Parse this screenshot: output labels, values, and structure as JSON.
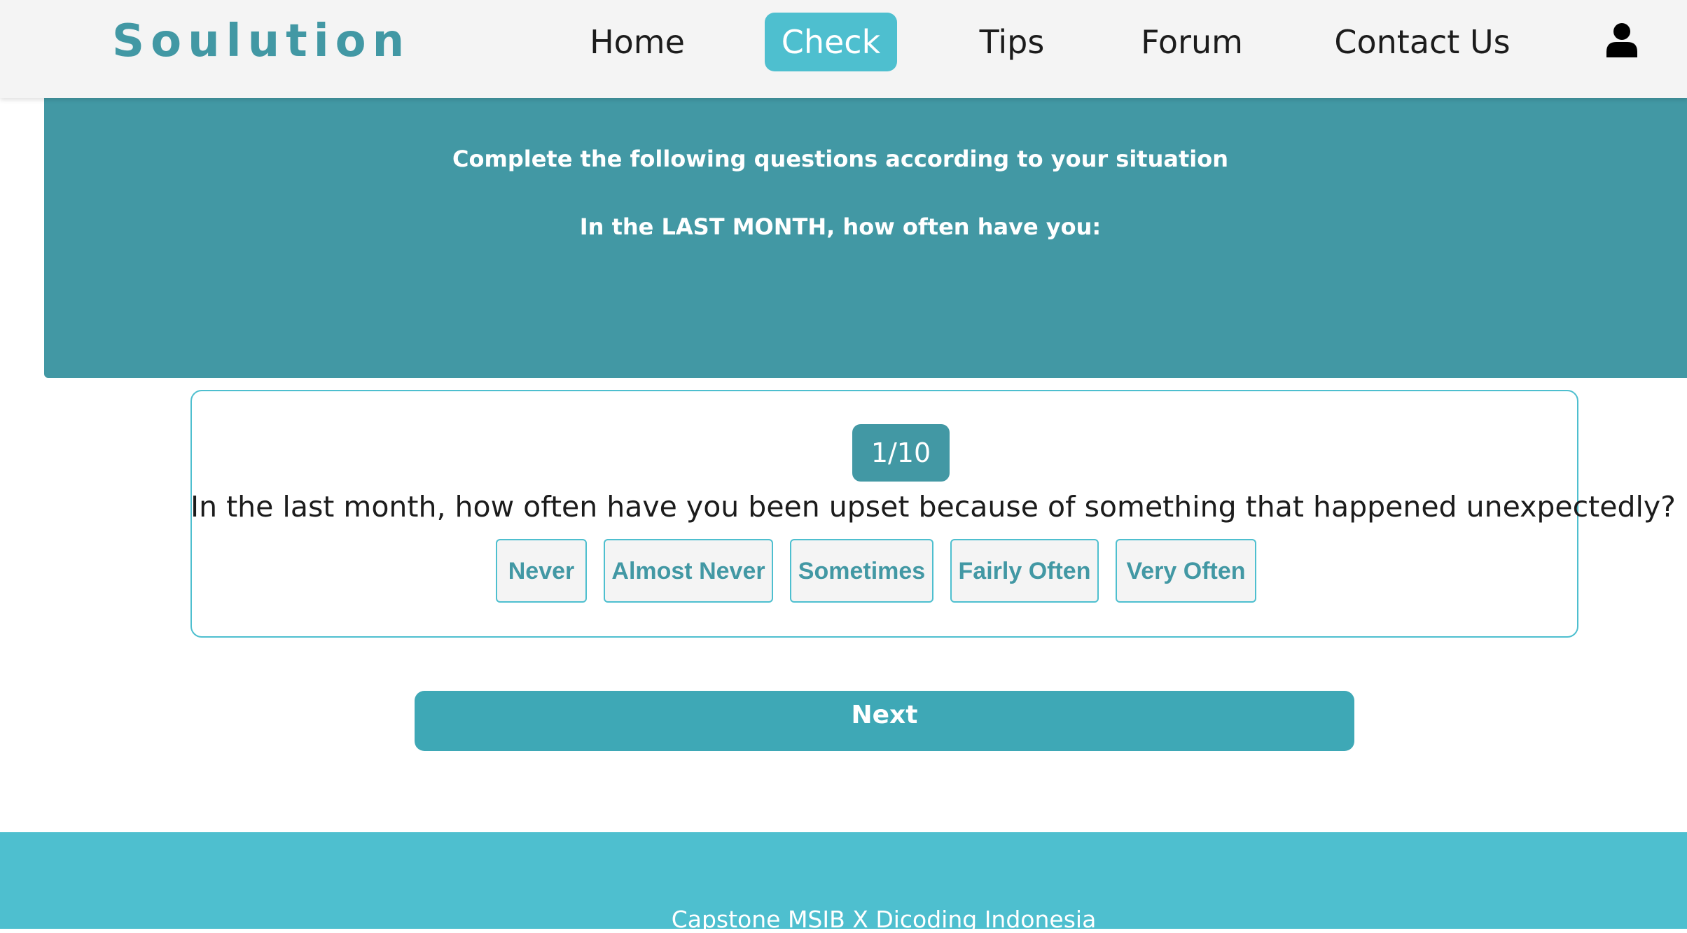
{
  "nav": {
    "brand": "Soulution",
    "links": [
      "Home",
      "Check",
      "Tips",
      "Forum",
      "Contact Us"
    ],
    "active": "Check",
    "user_icon": "user-icon"
  },
  "banner": {
    "line1": "Complete the following questions according to your situation",
    "line2": "In the LAST MONTH, how often have you:"
  },
  "quiz": {
    "counter": "1/10",
    "question": "In the last month, how often have you been upset because of something that happened unexpectedly?",
    "options": [
      "Never",
      "Almost Never",
      "Sometimes",
      "Fairly Often",
      "Very Often"
    ],
    "next_label": "Next"
  },
  "footer": {
    "text": "Capstone MSIB X Dicoding Indonesia"
  },
  "colors": {
    "brand": "#4298a4",
    "accent": "#4ebfcf",
    "button": "#3ea8b6",
    "nav_bg": "#f4f4f4"
  }
}
